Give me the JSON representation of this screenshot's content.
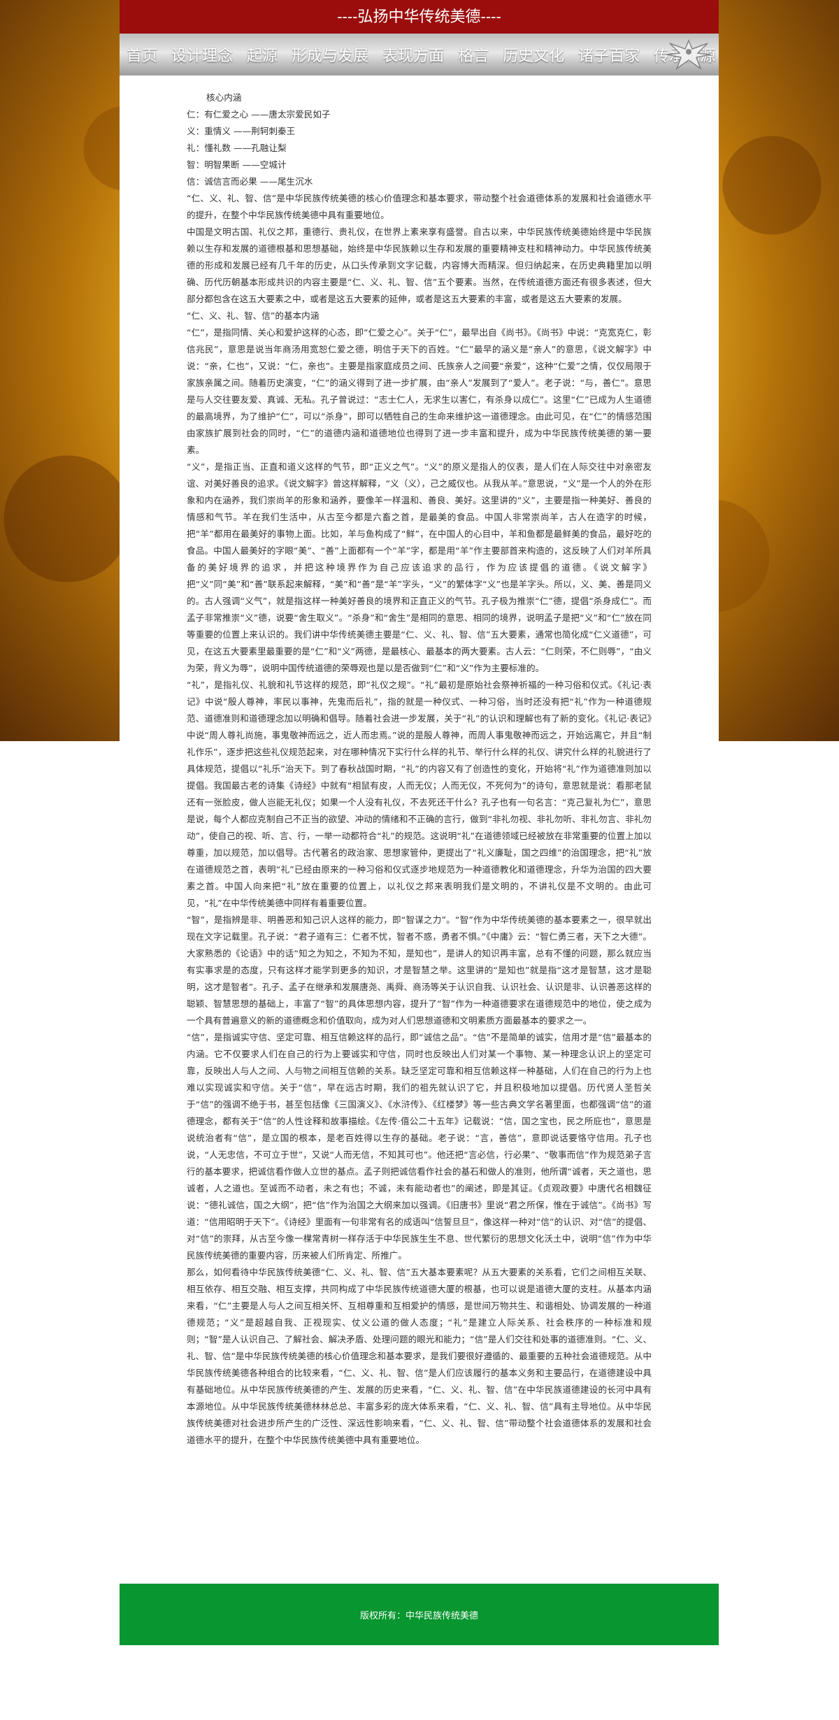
{
  "header": {
    "title": "----弘扬中华传统美德----"
  },
  "nav": {
    "items": [
      "首页",
      "设计理念",
      "起源",
      "形成与发展",
      "表现方面",
      "格言",
      "历史文化",
      "诸子百家",
      "传承渊源"
    ]
  },
  "content": {
    "paragraphs": [
      "核心内涵",
      "仁：有仁爱之心 ——唐太宗爱民如子",
      "义：重情义 ——荆轲刺秦王",
      "礼：懂礼数 ——孔融让梨",
      "智：明智果断 ——空城计",
      "信：诚信言而必果 ——尾生沉水",
      "“仁、义、礼、智、信”是中华民族传统美德的核心价值理念和基本要求，带动整个社会道德体系的发展和社会道德水平的提升，在整个中华民族传统美德中具有重要地位。",
      "中国是文明古国、礼仪之邦，重德行、贵礼仪，在世界上素来享有盛誉。自古以来，中华民族传统美德始终是中华民族赖以生存和发展的道德根基和思想基础，始终是中华民族赖以生存和发展的重要精神支柱和精神动力。中华民族传统美德的形成和发展已经有几千年的历史，从口头传承到文字记载，内容博大而精深。但归纳起来，在历史典籍里加以明确、历代历朝基本形成共识的内容主要是“仁、义、礼、智、信”五个要素。当然，在传统道德方面还有很多表述，但大部分都包含在这五大要素之中，或者是这五大要素的延伸，或者是这五大要素的丰富，或者是这五大要素的发展。",
      "“仁、义、礼、智、信”的基本内涵",
      "“仁”，是指同情、关心和爱护这样的心态，即“仁爱之心”。关于“仁”，最早出自《尚书》。《尚书》中说：“克宽克仁，彰信兆民”，意思是说当年商汤用宽恕仁爱之德，明信于天下的百姓。“仁”最早的涵义是“亲人”的意思，《说文解字》中说：“亲，仁也”，又说：“仁，亲也”。主要是指家庭成员之间、氏族亲人之间要“亲爱”，这种“仁爱”之情，仅仅局限于家族亲属之间。随着历史演变，“仁”的涵义得到了进一步扩展，由“亲人”发展到了“爱人”。老子说：“与，善仁”。意思是与人交往要友爱、真诚、无私。孔子曾说过：“志士仁人，无求生以害仁，有杀身以成仁”。这里“仁”已成为人生道德的最高境界，为了维护“仁”，可以“杀身”，即可以牺牲自己的生命来维护这一道德理念。由此可见，在“仁”的情感范围由家族扩展到社会的同时，“仁”的道德内涵和道德地位也得到了进一步丰富和提升，成为中华民族传统美德的第一要素。",
      "“义”，是指正当、正直和道义这样的气节，即“正义之气”。“义”的原义是指人的仪表，是人们在人际交往中对亲密友谊、对美好善良的追求。《说文解字》曾这样解释，“义（义），己之威仪也。从我从羊。”意思说，“义”是一个人的外在形象和内在涵养，我们崇尚羊的形象和涵养，要像羊一样温和、善良、美好。这里讲的“义”，主要是指一种美好、善良的情感和气节。羊在我们生活中，从古至今都是六畜之首，是最美的食品。中国人非常崇尚羊，古人在造字的时候，把“羊”都用在最美好的事物上面。比如，羊与鱼构成了“鲜”，在中国人的心目中，羊和鱼都是最鲜美的食品，最好吃的食品。中国人最美好的字眼“美”、“善”上面都有一个“羊”字，都是用“羊”作主要部首来构造的，这反映了人们对羊所具备的美好境界的追求，并把这种境界作为自己应该追求的品行，作为应该提倡的道德。《说文解字》把“义”同“美”和“善”联系起来解释，“美”和“善”是“羊”字头，“义”的繁体字“义”也是羊字头。所以，义、美、善是同义的。古人强调“义气”，就是指这样一种美好善良的境界和正直正义的气节。孔子极为推崇“仁”德，提倡“杀身成仁”。而孟子非常推崇“义”德，说要“舍生取义”。“杀身”和“舍生”是相同的意思、相同的境界，说明孟子是把“义”和“仁”放在同等重要的位置上来认识的。我们讲中华传统美德主要是“仁、义、礼、智、信”五大要素，通常也简化成“仁义道德”，可见，在这五大要素里最重要的是“仁”和“义”两德，是最核心、最基本的两大要素。古人云：“仁则荣，不仁则辱”，“由义为荣，背义为辱”，说明中国传统道德的荣辱观也是以是否做到“仁”和“义”作为主要标准的。",
      "“礼”，是指礼仪、礼貌和礼节这样的规范，即“礼仪之规”。“礼”最初是原始社会祭神祈福的一种习俗和仪式。《礼记·表记》中说“殷人尊神，率民以事神，先鬼而后礼”，指的就是一种仪式、一种习俗，当时还没有把“礼”作为一种道德规范、道德准则和道德理念加以明确和倡导。随着社会进一步发展，关于“礼”的认识和理解也有了新的变化。《礼记·表记》中说“周人尊礼尚施，事鬼敬神而远之，近人而忠焉。”说的是殷人尊神，而周人事鬼敬神而远之，开始远离它，并且“制礼作乐”，逐步把这些礼仪规范起来，对在哪种情况下实行什么样的礼节、举行什么样的礼仪、讲究什么样的礼貌进行了具体规范，提倡以“礼乐”治天下。到了春秋战国时期，“礼”的内容又有了创造性的变化，开始将“礼”作为道德准则加以提倡。我国最古老的诗集《诗经》中就有“相鼠有皮，人而无仪；人而无仪，不死何为”的诗句，意思就是说：看那老鼠还有一张脸皮，做人岂能无礼仪；如果一个人没有礼仪，不去死还干什么？孔子也有一句名言：“克己复礼为仁”，意思是说，每个人都应克制自己不正当的欲望、冲动的情绪和不正确的言行，做到“非礼勿视、非礼勿听、非礼勿言、非礼勿动”，使自己的视、听、言、行，一举一动都符合“礼”的规范。这说明“礼”在道德领域已经被放在非常重要的位置上加以尊重，加以规范，加以倡导。古代著名的政治家、思想家管仲，更提出了“礼义廉耻，国之四维”的治国理念，把“礼”放在道德规范之首，表明“礼”已经由原来的一种习俗和仪式逐步地规范为一种道德教化和道德理念，升华为治国的四大要素之首。中国人向来把“礼”放在重要的位置上，以礼仪之邦来表明我们是文明的，不讲礼仪是不文明的。由此可见，“礼”在中华传统美德中同样有着重要位置。",
      "“智”，是指辨是非、明善恶和知己识人这样的能力，即“智谋之力”。“智”作为中华传统美德的基本要素之一，很早就出现在文字记载里。孔子说：“君子道有三：仁者不忧，智者不惑，勇者不惧。”《中庸》云：“智仁勇三者，天下之大德”。大家熟悉的《论语》中的话“知之为知之，不知为不知，是知也”，是讲人的知识再丰富，总有不懂的问题，那么就应当有实事求是的态度，只有这样才能学到更多的知识，才是智慧之举。这里讲的“是知也”就是指“这才是智慧，这才是聪明，这才是智者”。孔子、孟子在继承和发展唐尧、禹舜、商汤等关于认识自我、认识社会、认识是非、认识善恶这样的聪颖、智慧思想的基础上，丰富了“智”的具体思想内容，提升了“智”作为一种道德要求在道德规范中的地位，使之成为一个具有普遍意义的新的道德概念和价值取向，成为对人们思想道德和文明素质方面最基本的要求之一。",
      "“信”，是指诚实守信、坚定可靠、相互信赖这样的品行，即“诚信之品”。“信”不是简单的诚实，信用才是“信”最基本的内涵。它不仅要求人们在自己的行为上要诚实和守信，同时也反映出人们对某一个事物、某一种理念认识上的坚定可靠，反映出人与人之间、人与物之间相互信赖的关系。缺乏坚定可靠和相互信赖这样一种基础，人们在自己的行为上也难以实现诚实和守信。关于“信”，早在远古时期，我们的祖先就认识了它，并且积极地加以提倡。历代贤人圣哲关于“信”的强调不绝于书，甚至包括像《三国演义》、《水浒传》、《红楼梦》等一些古典文学名著里面，也都强调“信”的道德理念，都有关于“信”的人性诠释和故事描绘。《左传·僖公二十五年》记载说：“信，国之宝也，民之所庇也”，意思是说统治者有“信”，是立国的根本，是老百姓得以生存的基础。老子说：“言，善信”，意即说话要恪守信用。孔子也说，“人无忠信，不可立于世”，又说“人而无信，不知其可也”。他还把“言必信，行必果”、“敬事而信”作为规范弟子言行的基本要求，把诚信看作做人立世的基点。孟子则把诚信看作社会的基石和做人的准则，他所谓“诚者，天之道也，思诚者，人之道也。至诚而不动者，未之有也；不诚，未有能动者也”的阐述，即是其证。《贞观政要》中唐代名相魏征说：“德礼诚信，国之大纲”，把“信”作为治国之大纲来加以强调。《旧唐书》里说“君之所保，惟在于诚信”。《尚书》写道：“信用昭明于天下”。《诗经》里面有一句非常有名的成语叫“信誓旦旦”，像这样一种对“信”的认识、对“信”的提倡、对“信”的崇拜，从古至今像一棵常青树一样存活于中华民族生生不息、世代繁衍的思想文化沃土中，说明“信”作为中华民族传统美德的重要内容，历来被人们所肯定、所推广。",
      "那么，如何看待中华民族传统美德“仁、义、礼、智、信”五大基本要素呢？从五大要素的关系看，它们之间相互关联、相互依存、相互交融、相互支撑，共同构成了中华民族传统道德大厦的根基，也可以说是道德大厦的支柱。从基本内涵来看，“仁”主要是人与人之间互相关怀、互相尊重和互相爱护的情感，是世间万物共生、和谐相处、协调发展的一种道德规范；“义”是超越自我、正视现实、仗义公道的做人态度；“礼”是建立人际关系、社会秩序的一种标准和规则；“智”是人认识自己、了解社会、解决矛盾、处理问题的眼光和能力；“信”是人们交往和处事的道德准则。“仁、义、礼、智、信”是中华民族传统美德的核心价值理念和基本要求，是我们要很好遵循的、最重要的五种社会道德规范。从中华民族传统美德各种组合的比较来看，“仁、义、礼、智、信”是人们应该履行的基本义务和主要品行，在道德建设中具有基础地位。从中华民族传统美德的产生、发展的历史来看，“仁、义、礼、智、信”在中华民族道德建设的长河中具有本源地位。从中华民族传统美德林林总总、丰富多彩的庞大体系来看，“仁、义、礼、智、信”具有主导地位。从中华民族传统美德对社会进步所产生的广泛性、深远性影响来看，“仁、义、礼、智、信”带动整个社会道德体系的发展和社会道德水平的提升，在整个中华民族传统美德中具有重要地位。"
    ]
  },
  "footer": {
    "text": "版权所有：中华民族传统美德"
  },
  "colors": {
    "banner": "#9b0c0c",
    "footer": "#07962f",
    "text": "#333333"
  }
}
